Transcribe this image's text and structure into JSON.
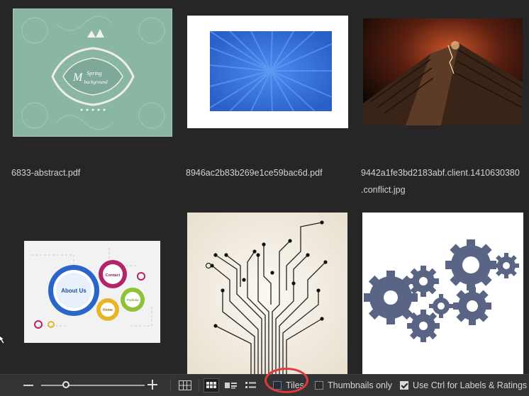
{
  "files": [
    {
      "name": "6833-abstract.pdf"
    },
    {
      "name": "8946ac2b83b269e1ce59bac6d.pdf"
    },
    {
      "name_line1": "9442a1fe3bd2183abf.client.1410630380",
      "name_line2": ".conflict.jpg"
    }
  ],
  "thumbnail_texts": {
    "spring_title": "Spring",
    "spring_sub": "background",
    "about_us": "About Us",
    "contact": "Contact",
    "portfolio": "Portfolio",
    "home": "Home"
  },
  "toolbar": {
    "tiles_label": "Tiles",
    "tiles_checked": false,
    "thumbnails_only_label": "Thumbnails only",
    "thumbnails_only_checked": false,
    "use_ctrl_label": "Use Ctrl for Labels & Ratings",
    "use_ctrl_checked": true,
    "zoom_level_fraction": 0.24,
    "active_view": "grid",
    "highlight_color": "#e03a3a"
  }
}
